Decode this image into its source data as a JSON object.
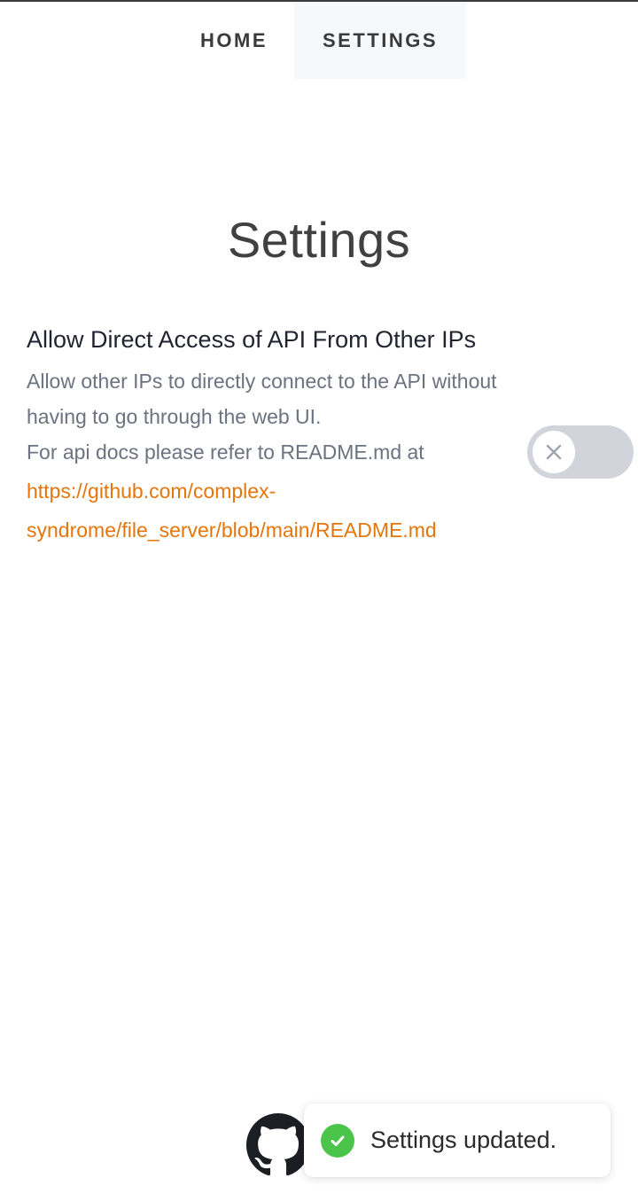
{
  "nav": {
    "items": [
      {
        "label": "HOME",
        "active": false
      },
      {
        "label": "SETTINGS",
        "active": true
      }
    ]
  },
  "page": {
    "title": "Settings"
  },
  "settings": {
    "direct_api_access": {
      "label": "Allow Direct Access of API From Other IPs",
      "description_line1": "Allow other IPs to directly connect to the API without having to go through the web UI.",
      "description_line2": "For api docs please refer to README.md at",
      "link_text": "https://github.com/complex-syndrome/file_server/blob/main/README.md",
      "enabled": false
    }
  },
  "footer": {
    "icon": "github-icon"
  },
  "toast": {
    "message": "Settings updated.",
    "status": "success",
    "status_color": "#4ac44a"
  },
  "colors": {
    "link": "#e4760c",
    "toggle_off": "#d1d5db"
  }
}
